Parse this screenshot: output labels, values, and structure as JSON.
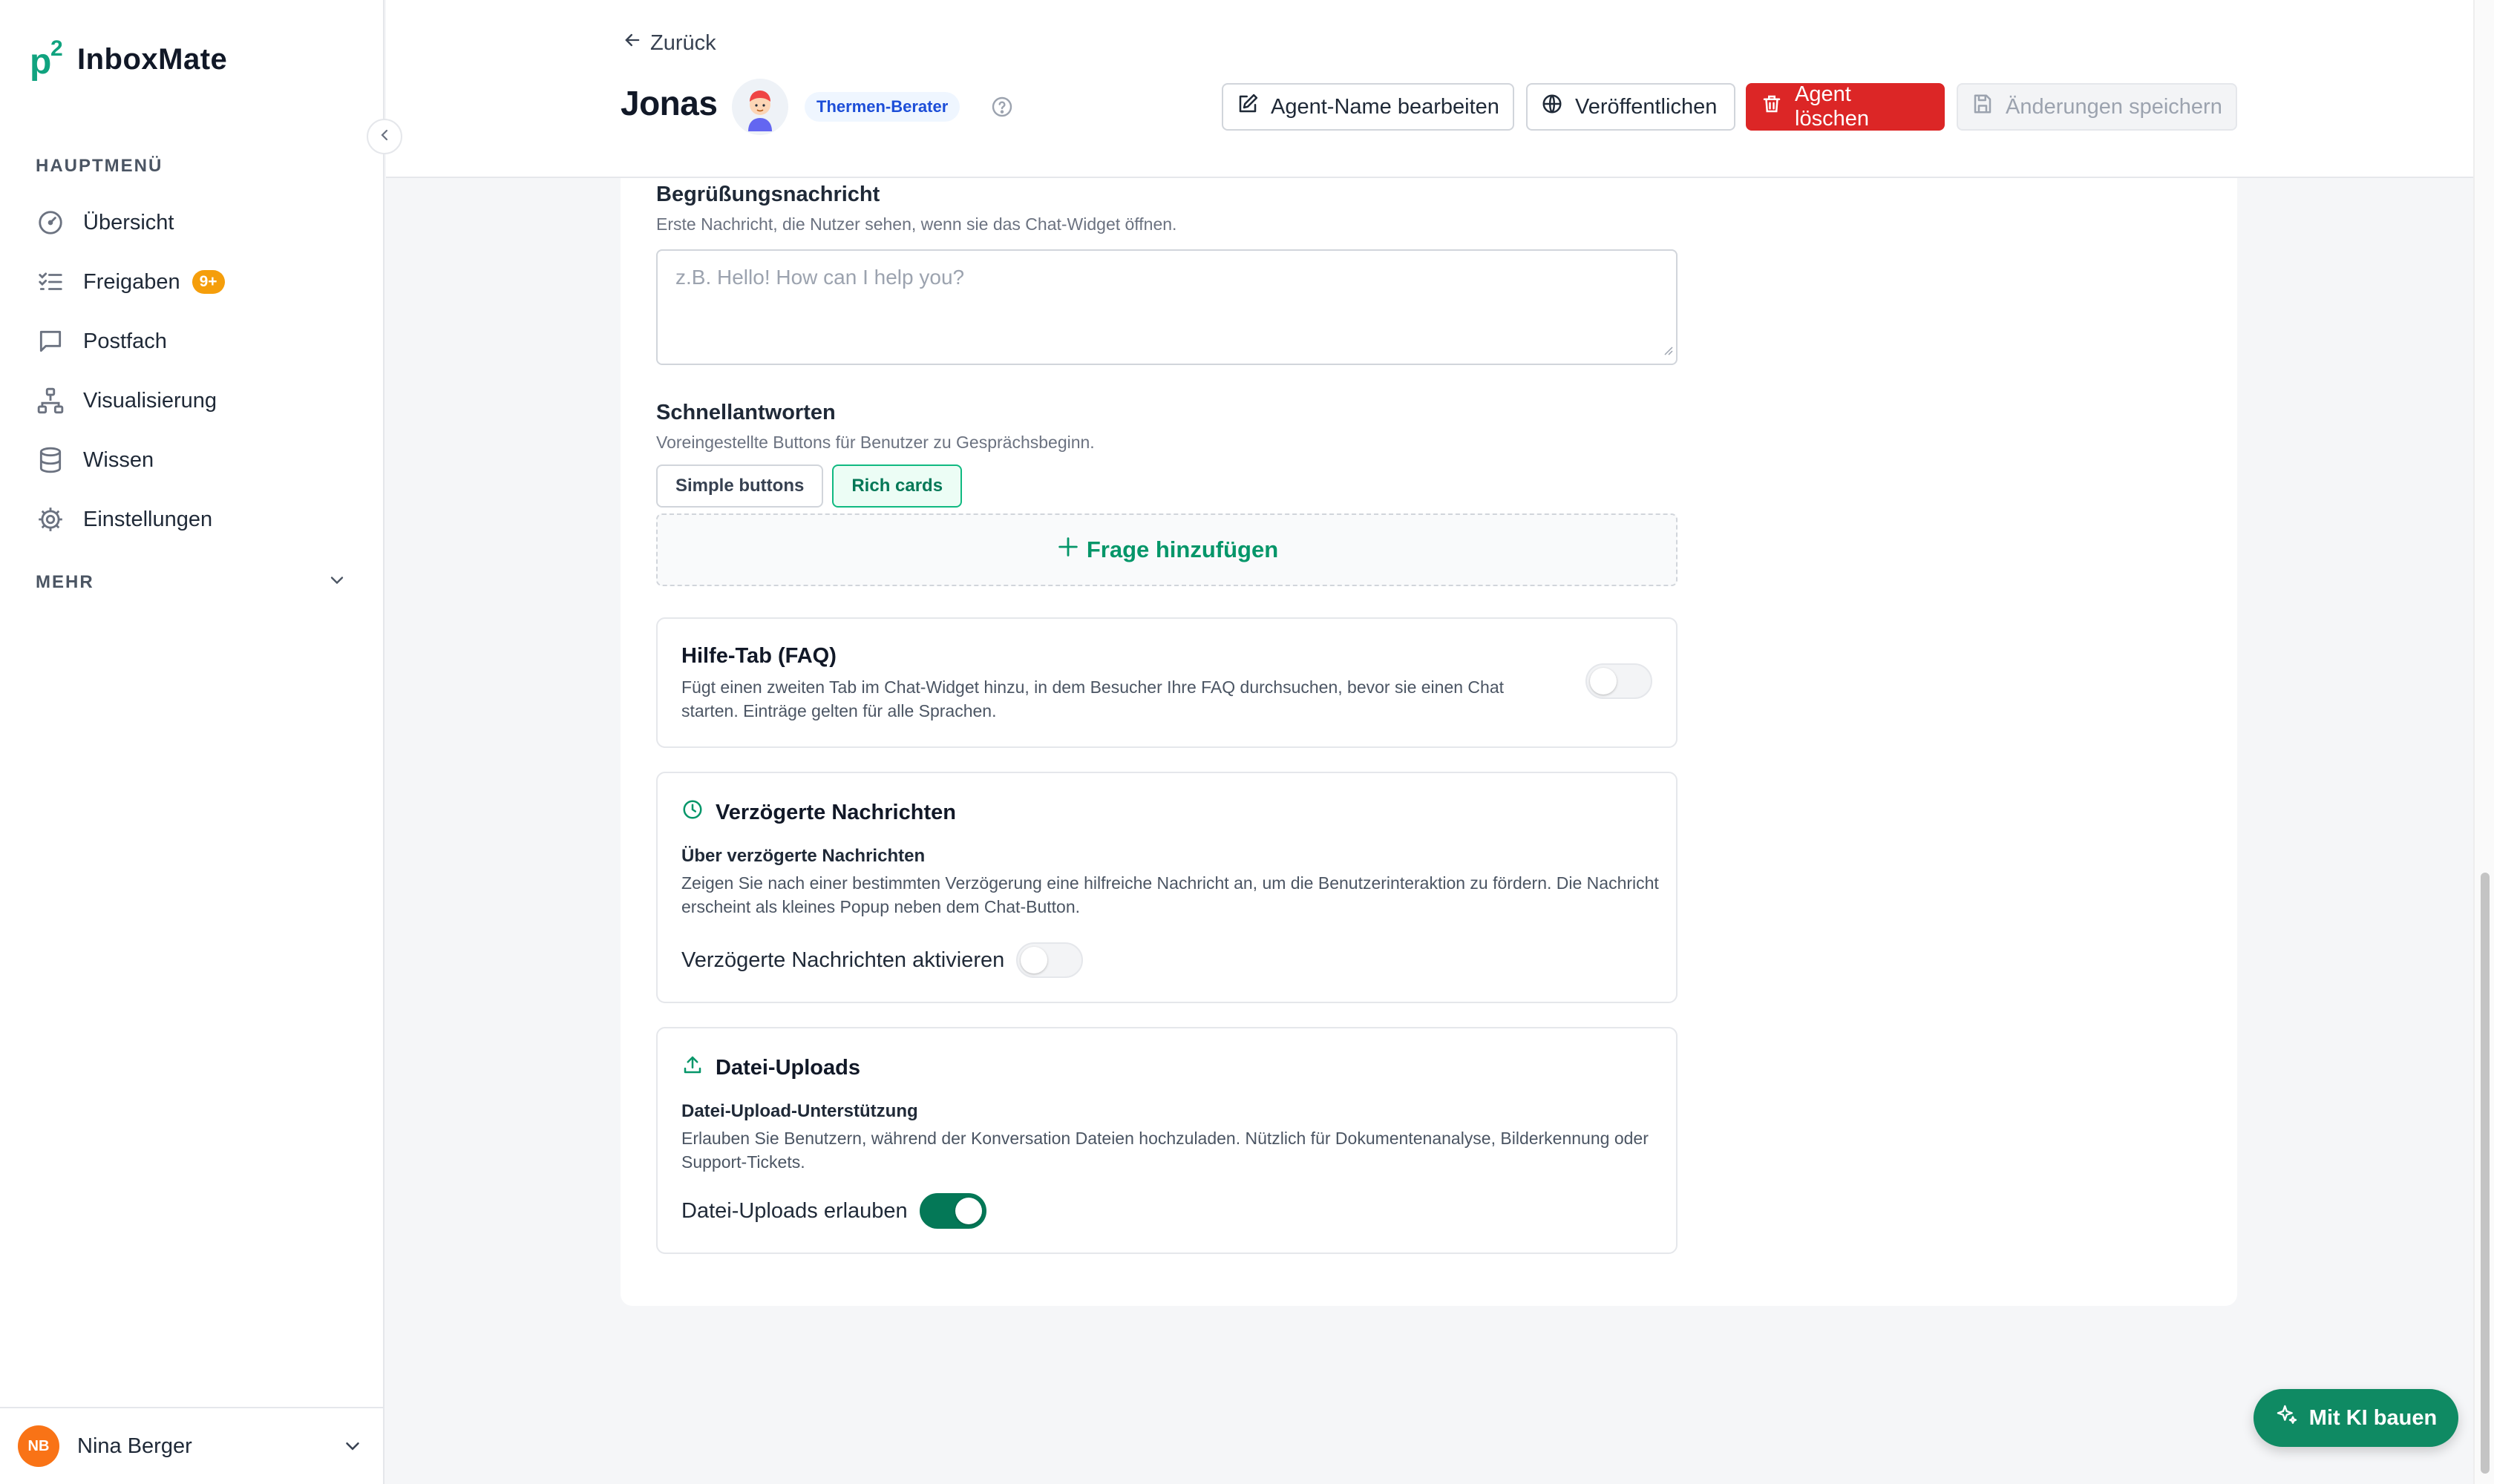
{
  "app": {
    "logo_mark": "p",
    "logo_sup": "2",
    "name": "InboxMate"
  },
  "sidebar": {
    "section_main": "HAUPTMENÜ",
    "items": [
      {
        "label": "Übersicht",
        "icon": "gauge-icon"
      },
      {
        "label": "Freigaben",
        "icon": "checklist-icon",
        "badge": "9+"
      },
      {
        "label": "Postfach",
        "icon": "chat-bubble-icon"
      },
      {
        "label": "Visualisierung",
        "icon": "hierarchy-icon"
      },
      {
        "label": "Wissen",
        "icon": "database-icon"
      },
      {
        "label": "Einstellungen",
        "icon": "gear-icon"
      }
    ],
    "section_more": "MEHR",
    "user": {
      "initials": "NB",
      "name": "Nina Berger"
    }
  },
  "header": {
    "back_label": "Zurück",
    "agent_name": "Jonas",
    "role": "Thermen-Berater",
    "buttons": {
      "edit_name": "Agent-Name bearbeiten",
      "publish": "Veröffentlichen",
      "delete": "Agent löschen",
      "save": "Änderungen speichern"
    }
  },
  "form": {
    "greeting": {
      "title": "Begrüßungsnachricht",
      "description": "Erste Nachricht, die Nutzer sehen, wenn sie das Chat-Widget öffnen.",
      "placeholder": "z.B. Hello! How can I help you?"
    },
    "quick_replies": {
      "title": "Schnellantworten",
      "description": "Voreingestellte Buttons für Benutzer zu Gesprächsbeginn.",
      "modes": [
        "Simple buttons",
        "Rich cards"
      ],
      "active_mode": "Rich cards",
      "add_label": "Frage hinzufügen"
    },
    "faq_tab": {
      "title": "Hilfe-Tab (FAQ)",
      "description": "Fügt einen zweiten Tab im Chat-Widget hinzu, in dem Besucher Ihre FAQ durchsuchen, bevor sie einen Chat starten. Einträge gelten für alle Sprachen.",
      "enabled": false
    },
    "delayed_messages": {
      "title": "Verzögerte Nachrichten",
      "subtitle": "Über verzögerte Nachrichten",
      "description": "Zeigen Sie nach einer bestimmten Verzögerung eine hilfreiche Nachricht an, um die Benutzerinteraktion zu fördern. Die Nachricht erscheint als kleines Popup neben dem Chat-Button.",
      "toggle_label": "Verzögerte Nachrichten aktivieren",
      "enabled": false
    },
    "file_uploads": {
      "title": "Datei-Uploads",
      "subtitle": "Datei-Upload-Unterstützung",
      "description": "Erlauben Sie Benutzern, während der Konversation Dateien hochzuladen. Nützlich für Dokumentenanalyse, Bilderkennung oder Support-Tickets.",
      "toggle_label": "Datei-Uploads erlauben",
      "enabled": true
    }
  },
  "fab": {
    "label": "Mit KI bauen"
  },
  "colors": {
    "brand": "#10a37f",
    "danger": "#dc2626",
    "accent_green": "#047857",
    "badge": "#f59e0b"
  }
}
